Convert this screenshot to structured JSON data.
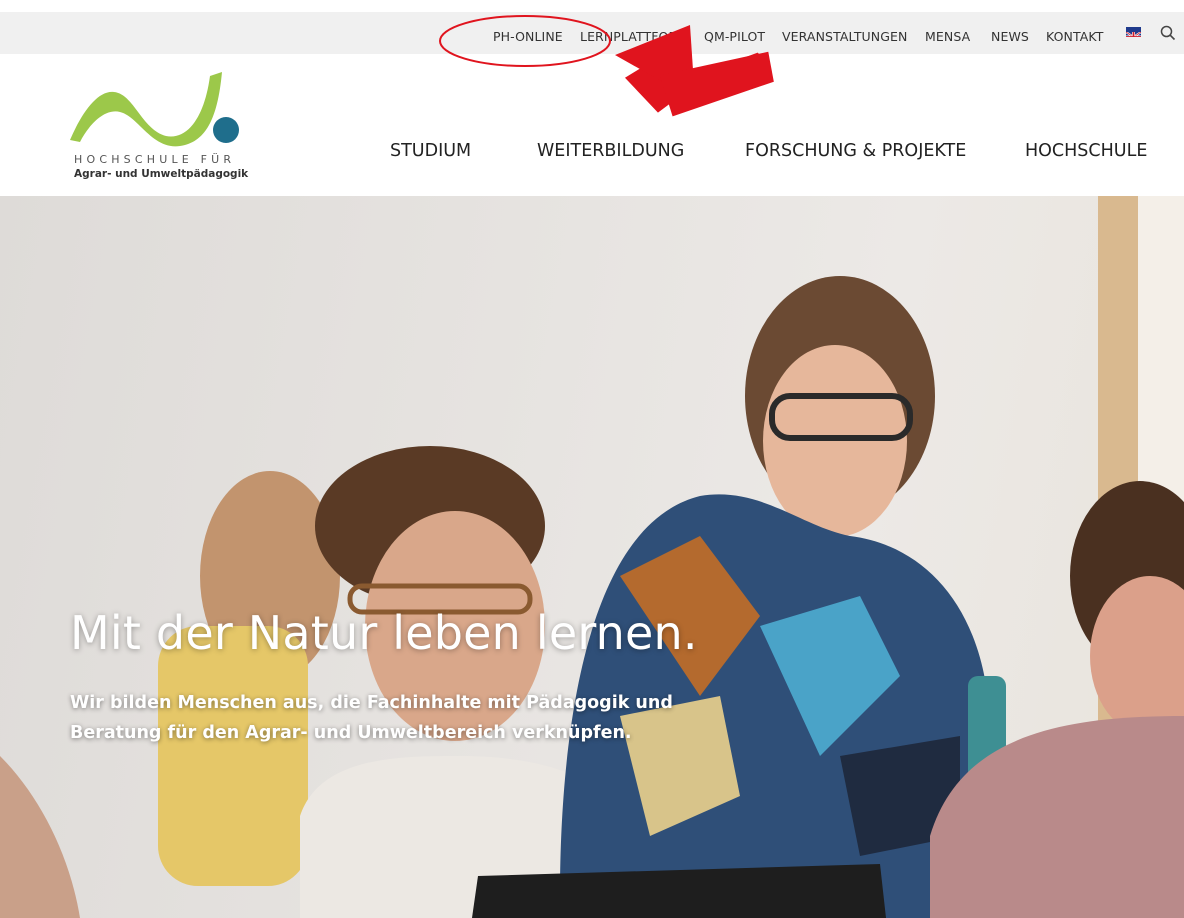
{
  "utility_nav": {
    "items": [
      "PH-ONLINE",
      "LERNPLATTFORM",
      "QM-PILOT",
      "VERANSTALTUNGEN",
      "MENSA",
      "NEWS",
      "KONTAKT"
    ]
  },
  "logo": {
    "line1": "HOCHSCHULE FÜR",
    "line2": "Agrar- und Umweltpädagogik"
  },
  "main_nav": {
    "items": [
      "STUDIUM",
      "WEITERBILDUNG",
      "FORSCHUNG & PROJEKTE",
      "HOCHSCHULE"
    ]
  },
  "hero": {
    "title": "Mit der Natur leben lernen.",
    "subtitle": "Wir bilden Menschen aus, die Fachinhalte mit Pädagogik und Beratung für den Agrar- und Umweltbereich verknüpfen."
  },
  "icons": {
    "flag": "uk-flag-icon",
    "search": "search-icon"
  },
  "colors": {
    "logo_green": "#9cc84a",
    "logo_blue": "#1f6e8c",
    "annotation_red": "#e0141e",
    "topbar_bg": "#f0f0f0"
  }
}
